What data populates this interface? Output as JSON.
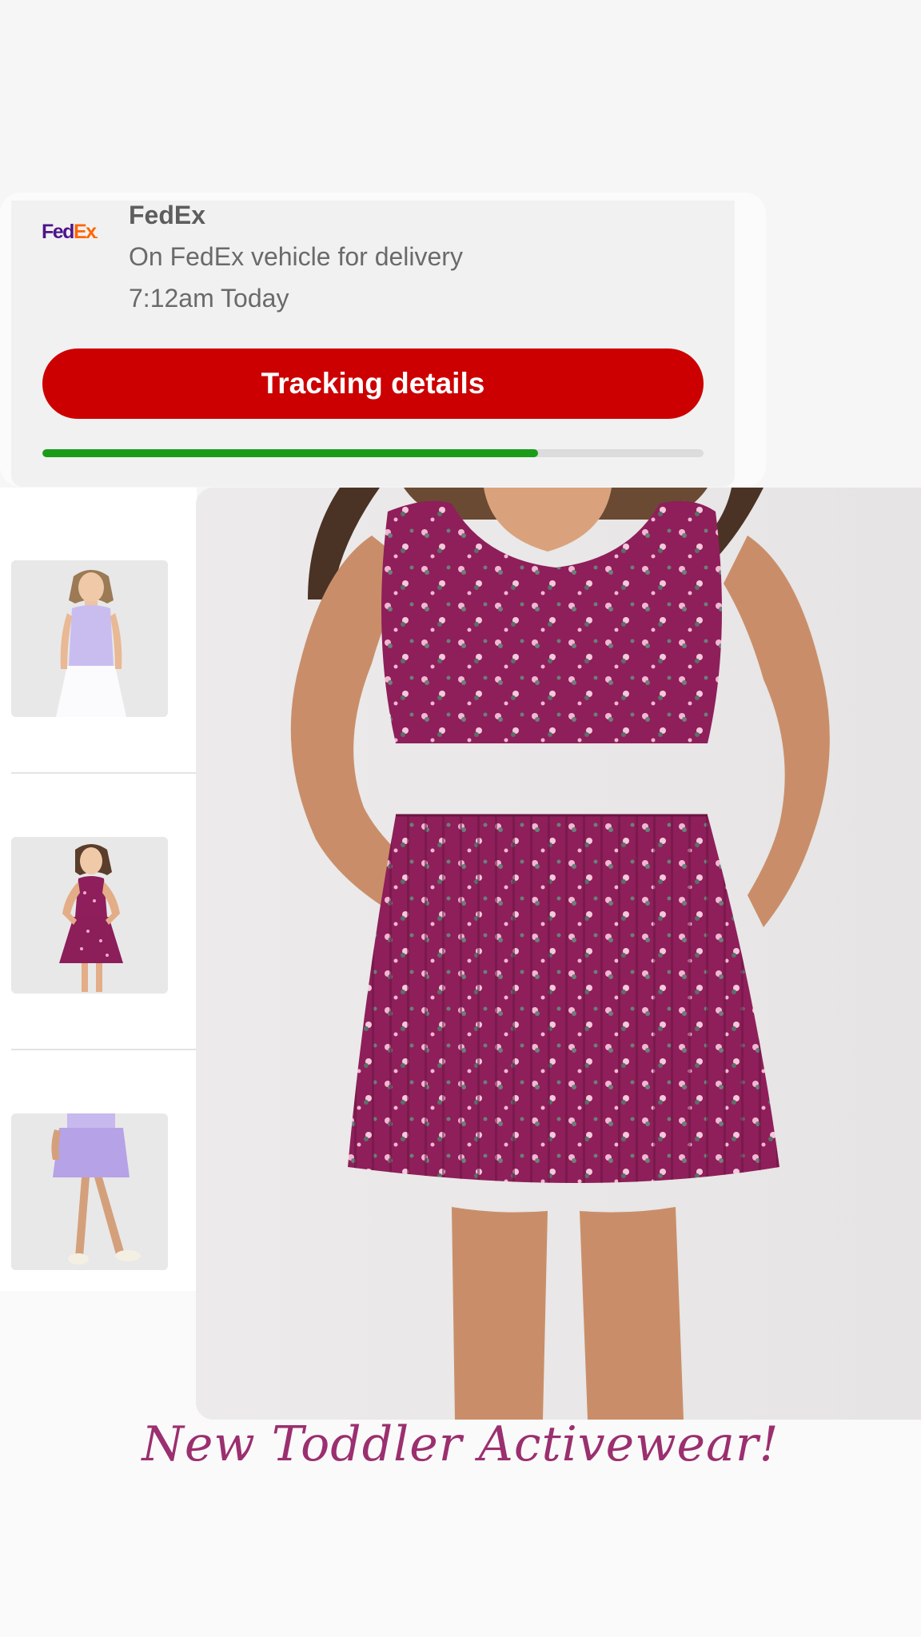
{
  "tracking": {
    "logo_text": "FedEx",
    "logo_fed": "Fed",
    "logo_ex": "Ex",
    "carrier_name": "FedEx",
    "status": "On FedEx vehicle for delivery",
    "time": "7:12am Today",
    "button_label": "Tracking details",
    "progress_percent": 75,
    "colors": {
      "button": "#cc0000",
      "progress": "#1a9c1a",
      "fedex_purple": "#4d148c",
      "fedex_orange": "#ff6600"
    }
  },
  "thumbnails": [
    {
      "name": "lavender-top-white-skirt-thumbnail"
    },
    {
      "name": "floral-dress-thumbnail"
    },
    {
      "name": "lavender-skirt-legs-thumbnail"
    }
  ],
  "main_image": {
    "name": "floral-pleated-dress-photo"
  },
  "promo": {
    "caption": "New Toddler Activewear!",
    "color": "#9b2f6f"
  }
}
